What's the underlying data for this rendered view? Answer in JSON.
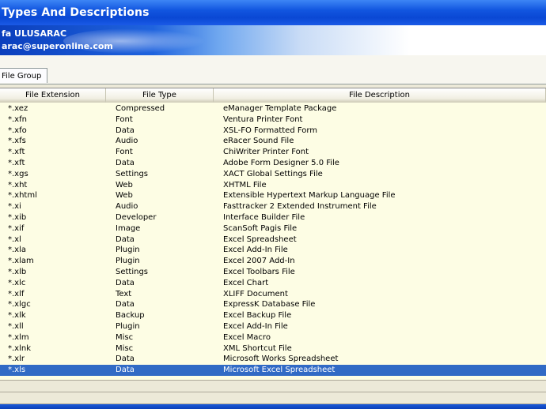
{
  "window": {
    "title": "Types And Descriptions"
  },
  "banner": {
    "author": "fa ULUSARAC",
    "email": "arac@superonline.com"
  },
  "tabs": [
    {
      "label": "File Group"
    }
  ],
  "grid": {
    "columns": [
      "File Extension",
      "File Type",
      "File Description"
    ],
    "rows": [
      {
        "ext": "*.xez",
        "type": "Compressed",
        "desc": "eManager Template Package"
      },
      {
        "ext": "*.xfn",
        "type": "Font",
        "desc": "Ventura Printer Font"
      },
      {
        "ext": "*.xfo",
        "type": "Data",
        "desc": "XSL-FO Formatted Form"
      },
      {
        "ext": "*.xfs",
        "type": "Audio",
        "desc": "eRacer Sound File"
      },
      {
        "ext": "*.xft",
        "type": "Font",
        "desc": "ChiWriter Printer Font"
      },
      {
        "ext": "*.xft",
        "type": "Data",
        "desc": "Adobe Form Designer 5.0 File"
      },
      {
        "ext": "*.xgs",
        "type": "Settings",
        "desc": "XACT Global Settings File"
      },
      {
        "ext": "*.xht",
        "type": "Web",
        "desc": "XHTML File"
      },
      {
        "ext": "*.xhtml",
        "type": "Web",
        "desc": "Extensible Hypertext Markup Language File"
      },
      {
        "ext": "*.xi",
        "type": "Audio",
        "desc": "Fasttracker 2 Extended Instrument File"
      },
      {
        "ext": "*.xib",
        "type": "Developer",
        "desc": "Interface Builder File"
      },
      {
        "ext": "*.xif",
        "type": "Image",
        "desc": "ScanSoft Pagis File"
      },
      {
        "ext": "*.xl",
        "type": "Data",
        "desc": "Excel Spreadsheet"
      },
      {
        "ext": "*.xla",
        "type": "Plugin",
        "desc": "Excel Add-In File"
      },
      {
        "ext": "*.xlam",
        "type": "Plugin",
        "desc": "Excel 2007 Add-In"
      },
      {
        "ext": "*.xlb",
        "type": "Settings",
        "desc": "Excel Toolbars File"
      },
      {
        "ext": "*.xlc",
        "type": "Data",
        "desc": "Excel Chart"
      },
      {
        "ext": "*.xlf",
        "type": "Text",
        "desc": "XLIFF Document"
      },
      {
        "ext": "*.xlgc",
        "type": "Data",
        "desc": "ExpressK Database File"
      },
      {
        "ext": "*.xlk",
        "type": "Backup",
        "desc": "Excel Backup File"
      },
      {
        "ext": "*.xll",
        "type": "Plugin",
        "desc": "Excel Add-In File"
      },
      {
        "ext": "*.xlm",
        "type": "Misc",
        "desc": "Excel Macro"
      },
      {
        "ext": "*.xlnk",
        "type": "Misc",
        "desc": "XML Shortcut File"
      },
      {
        "ext": "*.xlr",
        "type": "Data",
        "desc": "Microsoft Works Spreadsheet"
      },
      {
        "ext": "*.xls",
        "type": "Data",
        "desc": "Microsoft Excel Spreadsheet",
        "selected": true
      }
    ]
  },
  "colors": {
    "titlebar": "#0a48d4",
    "selection": "#316ac5",
    "grid_bg": "#fdfde4"
  }
}
